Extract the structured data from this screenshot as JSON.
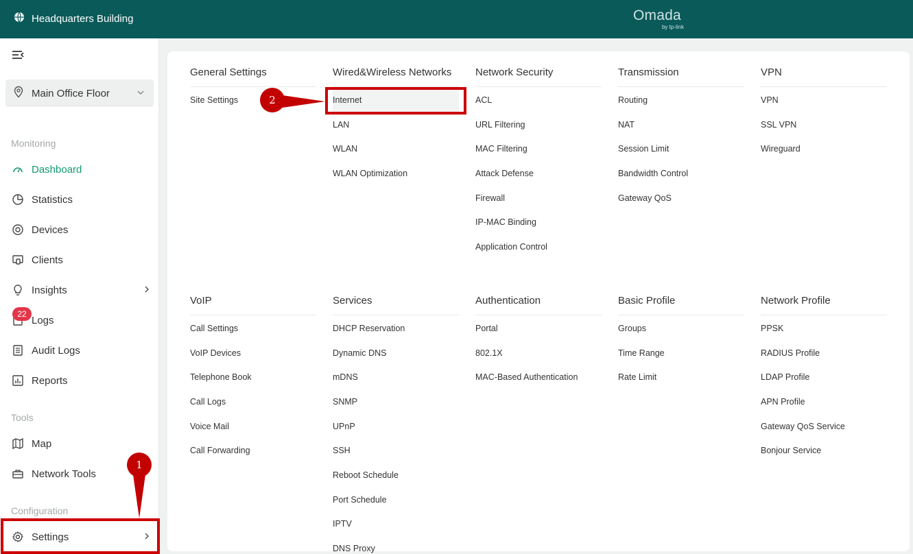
{
  "header": {
    "site_name": "Headquarters Building",
    "brand_name": "Omada",
    "brand_sub": "by tp-link",
    "bg_color": "#0b5a5a"
  },
  "sidebar": {
    "site_selector": "Main Office Floor",
    "sections": {
      "monitoring": "Monitoring",
      "tools": "Tools",
      "configuration": "Configuration"
    },
    "items": [
      {
        "label": "Dashboard",
        "icon": "dashboard-icon",
        "active": true
      },
      {
        "label": "Statistics",
        "icon": "pie-chart-icon"
      },
      {
        "label": "Devices",
        "icon": "devices-icon"
      },
      {
        "label": "Clients",
        "icon": "clients-icon"
      },
      {
        "label": "Insights",
        "icon": "lightbulb-icon",
        "has_submenu": true
      },
      {
        "label": "Logs",
        "icon": "logs-icon",
        "badge": "22"
      },
      {
        "label": "Audit Logs",
        "icon": "audit-logs-icon"
      },
      {
        "label": "Reports",
        "icon": "reports-icon"
      },
      {
        "label": "Map",
        "icon": "map-icon"
      },
      {
        "label": "Network Tools",
        "icon": "toolbox-icon"
      },
      {
        "label": "Settings",
        "icon": "gear-icon",
        "has_submenu": true
      }
    ],
    "active_color": "#129a71"
  },
  "settings_menu": {
    "row1": [
      {
        "title": "General Settings",
        "items": [
          "Site Settings"
        ]
      },
      {
        "title": "Wired&Wireless Networks",
        "items": [
          "Internet",
          "LAN",
          "WLAN",
          "WLAN Optimization"
        ]
      },
      {
        "title": "Network Security",
        "items": [
          "ACL",
          "URL Filtering",
          "MAC Filtering",
          "Attack Defense",
          "Firewall",
          "IP-MAC Binding",
          "Application Control"
        ]
      },
      {
        "title": "Transmission",
        "items": [
          "Routing",
          "NAT",
          "Session Limit",
          "Bandwidth Control",
          "Gateway QoS"
        ]
      },
      {
        "title": "VPN",
        "items": [
          "VPN",
          "SSL VPN",
          "Wireguard"
        ]
      }
    ],
    "row2": [
      {
        "title": "VoIP",
        "items": [
          "Call Settings",
          "VoIP Devices",
          "Telephone Book",
          "Call Logs",
          "Voice Mail",
          "Call Forwarding"
        ]
      },
      {
        "title": "Services",
        "items": [
          "DHCP Reservation",
          "Dynamic DNS",
          "mDNS",
          "SNMP",
          "UPnP",
          "SSH",
          "Reboot Schedule",
          "Port Schedule",
          "IPTV",
          "DNS Proxy"
        ]
      },
      {
        "title": "Authentication",
        "items": [
          "Portal",
          "802.1X",
          "MAC-Based Authentication"
        ]
      },
      {
        "title": "Basic Profile",
        "items": [
          "Groups",
          "Time Range",
          "Rate Limit"
        ]
      },
      {
        "title": "Network Profile",
        "items": [
          "PPSK",
          "RADIUS Profile",
          "LDAP Profile",
          "APN Profile",
          "Gateway QoS Service",
          "Bonjour Service"
        ]
      }
    ]
  },
  "annotations": {
    "marker1": "1",
    "marker2": "2",
    "color": "#cc0000"
  }
}
